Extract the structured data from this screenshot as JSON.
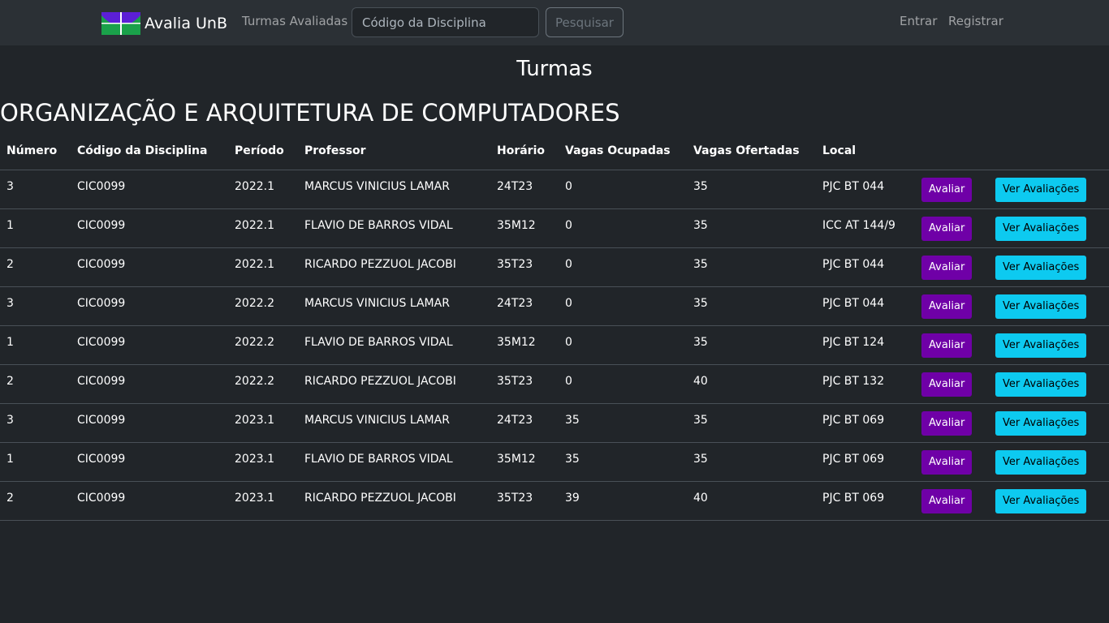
{
  "navbar": {
    "brand": "Avalia UnB",
    "turmas_link": "Turmas Avaliadas",
    "search_placeholder": "Código da Disciplina",
    "search_button": "Pesquisar",
    "login": "Entrar",
    "register": "Registrar",
    "colors": {
      "logo_purple": "#5c1fd6",
      "logo_green": "#1aa14a",
      "logo_blue": "#0a47a1"
    }
  },
  "page": {
    "title": "Turmas",
    "discipline_name": "ORGANIZAÇÃO E ARQUITETURA DE COMPUTADORES"
  },
  "table": {
    "headers": [
      "Número",
      "Código da Disciplina",
      "Período",
      "Professor",
      "Horário",
      "Vagas Ocupadas",
      "Vagas Ofertadas",
      "Local",
      "",
      ""
    ],
    "avaliar_label": "Avaliar",
    "ver_label": "Ver Avaliações",
    "rows": [
      {
        "numero": "3",
        "codigo": "CIC0099",
        "periodo": "2022.1",
        "professor": "MARCUS VINICIUS LAMAR",
        "horario": "24T23",
        "ocupadas": "0",
        "ofertadas": "35",
        "local": "PJC BT 044"
      },
      {
        "numero": "1",
        "codigo": "CIC0099",
        "periodo": "2022.1",
        "professor": "FLAVIO DE BARROS VIDAL",
        "horario": "35M12",
        "ocupadas": "0",
        "ofertadas": "35",
        "local": "ICC AT 144/9"
      },
      {
        "numero": "2",
        "codigo": "CIC0099",
        "periodo": "2022.1",
        "professor": "RICARDO PEZZUOL JACOBI",
        "horario": "35T23",
        "ocupadas": "0",
        "ofertadas": "35",
        "local": "PJC BT 044"
      },
      {
        "numero": "3",
        "codigo": "CIC0099",
        "periodo": "2022.2",
        "professor": "MARCUS VINICIUS LAMAR",
        "horario": "24T23",
        "ocupadas": "0",
        "ofertadas": "35",
        "local": "PJC BT 044"
      },
      {
        "numero": "1",
        "codigo": "CIC0099",
        "periodo": "2022.2",
        "professor": "FLAVIO DE BARROS VIDAL",
        "horario": "35M12",
        "ocupadas": "0",
        "ofertadas": "35",
        "local": "PJC BT 124"
      },
      {
        "numero": "2",
        "codigo": "CIC0099",
        "periodo": "2022.2",
        "professor": "RICARDO PEZZUOL JACOBI",
        "horario": "35T23",
        "ocupadas": "0",
        "ofertadas": "40",
        "local": "PJC BT 132"
      },
      {
        "numero": "3",
        "codigo": "CIC0099",
        "periodo": "2023.1",
        "professor": "MARCUS VINICIUS LAMAR",
        "horario": "24T23",
        "ocupadas": "35",
        "ofertadas": "35",
        "local": "PJC BT 069"
      },
      {
        "numero": "1",
        "codigo": "CIC0099",
        "periodo": "2023.1",
        "professor": "FLAVIO DE BARROS VIDAL",
        "horario": "35M12",
        "ocupadas": "35",
        "ofertadas": "35",
        "local": "PJC BT 069"
      },
      {
        "numero": "2",
        "codigo": "CIC0099",
        "periodo": "2023.1",
        "professor": "RICARDO PEZZUOL JACOBI",
        "horario": "35T23",
        "ocupadas": "39",
        "ofertadas": "40",
        "local": "PJC BT 069"
      }
    ]
  }
}
